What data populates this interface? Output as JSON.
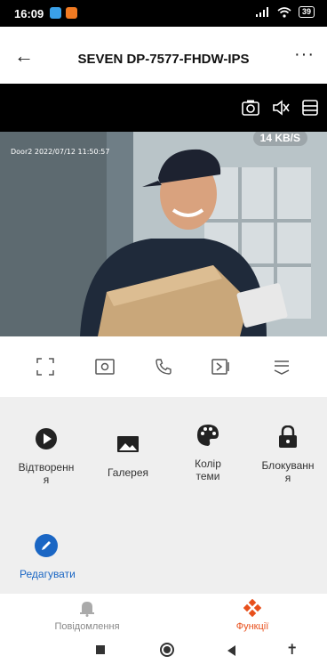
{
  "status": {
    "time": "16:09",
    "battery": "39"
  },
  "header": {
    "title": "SEVEN DP-7577-FHDW-IPS"
  },
  "video": {
    "timestamp": "Door2 2022/07/12 11:50:57",
    "rate": "14 KB/S"
  },
  "functions": {
    "playback": "Відтворення",
    "gallery": "Галерея",
    "theme_color": "Колір теми",
    "lock": "Блокування",
    "edit": "Редагувати"
  },
  "nav": {
    "notifications": "Повідомлення",
    "functions": "Функції"
  },
  "colors": {
    "accent": "#e8501c",
    "edit": "#1a66c4"
  }
}
